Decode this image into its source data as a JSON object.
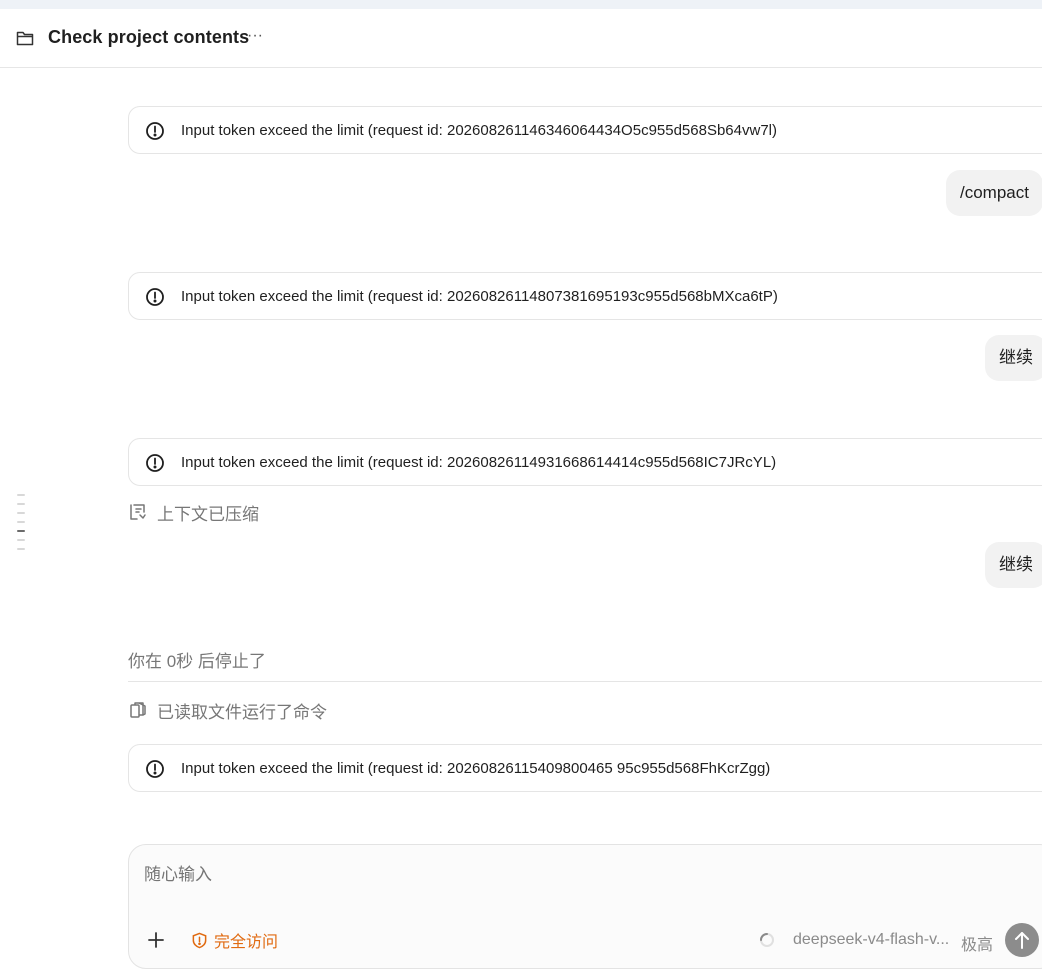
{
  "header": {
    "title": "Check project contents",
    "more_label": "···"
  },
  "messages": {
    "error_1": "Input token exceed the limit (request id: 202608261146346064434O5c955d568Sb64vw7l)",
    "user_1": "/compact",
    "error_2": "Input token exceed the limit (request id: 20260826114807381695193c955d568bMXca6tP)",
    "user_2": "继续",
    "error_3": "Input token exceed the limit (request id: 20260826114931668614414c955d568IC7JRcYL)",
    "context_compressed": "上下文已压缩",
    "user_3": "继续",
    "stopped": "你在 0秒 后停止了",
    "read_files": "已读取文件运行了命令",
    "error_4": "Input token exceed the limit (request id: 20260826115409800465 95c955d568FhKcrZgg)"
  },
  "composer": {
    "placeholder": "随心输入",
    "access_label": "完全访问",
    "model_label": "deepseek-v4-flash-v...",
    "effort_label": "极高"
  },
  "colors": {
    "accent_orange": "#e06a10",
    "send_button": "#8c8c8c",
    "muted_text": "#777777"
  },
  "icons": [
    "folder-icon",
    "more-icon",
    "alert-circle-icon",
    "context-compress-icon",
    "files-icon",
    "plus-icon",
    "warning-icon",
    "spinner-icon",
    "arrow-up-icon"
  ]
}
